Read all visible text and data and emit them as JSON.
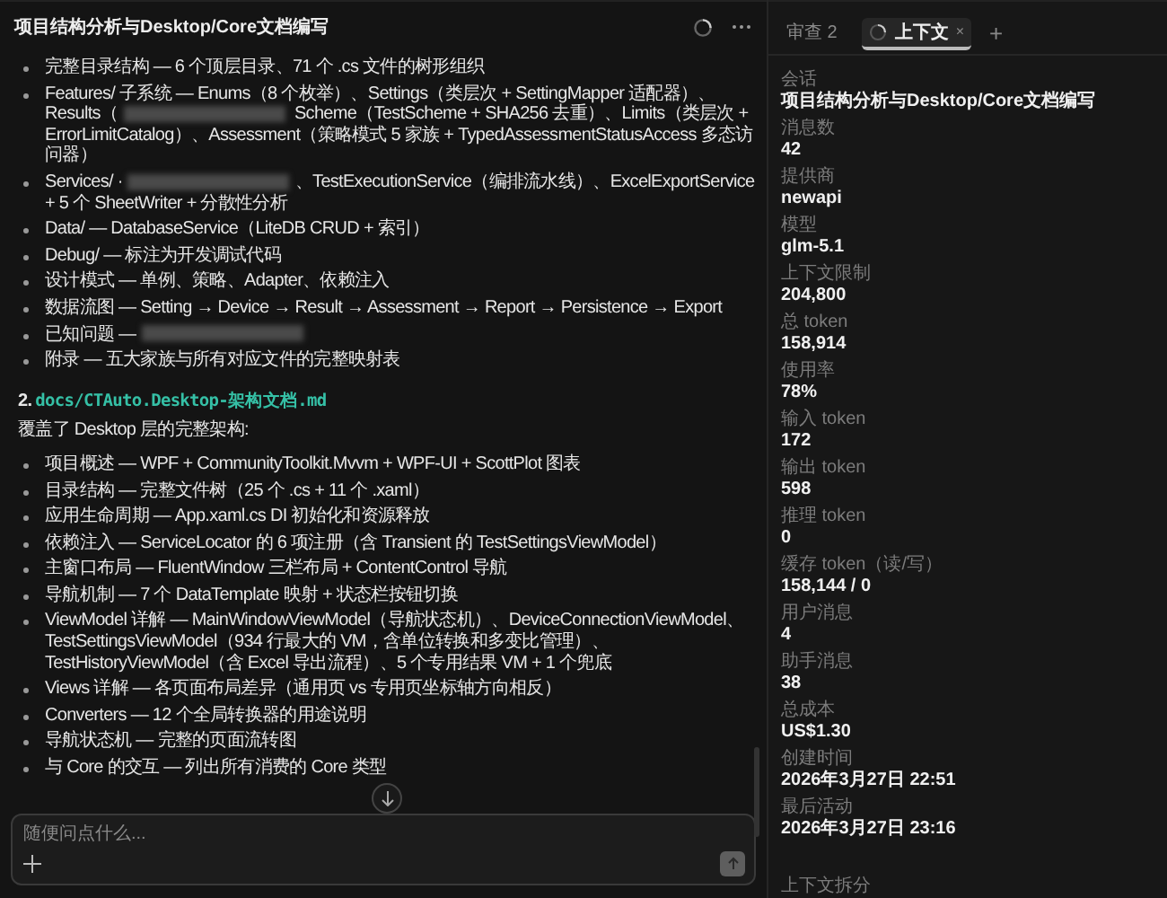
{
  "header": {
    "title": "项目结构分析与Desktop/Core文档编写"
  },
  "message": {
    "list_1": [
      {
        "parts": [
          {
            "kind": "text",
            "text": "完整目录结构 — 6 个顶层目录、71 个 .cs 文件的树形组织"
          }
        ]
      },
      {
        "parts": [
          {
            "kind": "text",
            "text": "Features/ 子系统 — Enums（8 个枚举）、Settings（类层次 + SettingMapper 适配器）、Results（"
          },
          {
            "kind": "redacted"
          },
          {
            "kind": "text",
            "text": " Scheme（TestScheme + SHA256 去重）、Limits（类层次 + ErrorLimitCatalog）、Assessment（策略模式 5 家族 + TypedAssessmentStatusAccess 多态访问器）"
          }
        ]
      },
      {
        "parts": [
          {
            "kind": "text",
            "text": "Services/ ·"
          },
          {
            "kind": "redacted"
          },
          {
            "kind": "text",
            "text": "、TestExecutionService（编排流水线）、ExcelExportService + 5 个 SheetWriter + 分散性分析"
          }
        ]
      },
      {
        "parts": [
          {
            "kind": "text",
            "text": "Data/ — DatabaseService（LiteDB CRUD + 索引）"
          }
        ]
      },
      {
        "parts": [
          {
            "kind": "text",
            "text": "Debug/ — 标注为开发调试代码"
          }
        ]
      },
      {
        "parts": [
          {
            "kind": "text",
            "text": "设计模式 — 单例、策略、Adapter、依赖注入"
          }
        ]
      },
      {
        "parts": [
          {
            "kind": "text",
            "text": "数据流图 — Setting → Device → Result → Assessment → Report → Persistence → Export"
          }
        ]
      },
      {
        "parts": [
          {
            "kind": "text",
            "text": "已知问题 —"
          },
          {
            "kind": "redacted"
          }
        ]
      },
      {
        "parts": [
          {
            "kind": "text",
            "text": "附录 — 五大家族与所有对应文件的完整映射表"
          }
        ]
      }
    ],
    "heading": {
      "number": "2.",
      "link": "docs/CTAuto.Desktop-架构文档.md"
    },
    "paragraph": "覆盖了 Desktop 层的完整架构:",
    "list_2": [
      {
        "parts": [
          {
            "kind": "text",
            "text": "项目概述 — WPF + CommunityToolkit.Mvvm + WPF-UI + ScottPlot 图表"
          }
        ]
      },
      {
        "parts": [
          {
            "kind": "text",
            "text": "目录结构 — 完整文件树（25 个 .cs + 11 个 .xaml）"
          }
        ]
      },
      {
        "parts": [
          {
            "kind": "text",
            "text": "应用生命周期 — App.xaml.cs DI 初始化和资源释放"
          }
        ]
      },
      {
        "parts": [
          {
            "kind": "text",
            "text": "依赖注入 — ServiceLocator 的 6 项注册（含 Transient 的 TestSettingsViewModel）"
          }
        ]
      },
      {
        "parts": [
          {
            "kind": "text",
            "text": "主窗口布局 — FluentWindow 三栏布局 + ContentControl 导航"
          }
        ]
      },
      {
        "parts": [
          {
            "kind": "text",
            "text": "导航机制 — 7 个 DataTemplate 映射 + 状态栏按钮切换"
          }
        ]
      },
      {
        "parts": [
          {
            "kind": "text",
            "text": "ViewModel 详解 — MainWindowViewModel（导航状态机）、DeviceConnectionViewModel、TestSettingsViewModel（934 行最大的 VM，含单位转换和多变比管理）、TestHistoryViewModel（含 Excel 导出流程）、5 个专用结果 VM + 1 个兜底"
          }
        ]
      },
      {
        "parts": [
          {
            "kind": "text",
            "text": "Views 详解 — 各页面布局差异（通用页 vs 专用页坐标轴方向相反）"
          }
        ]
      },
      {
        "parts": [
          {
            "kind": "text",
            "text": "Converters — 12 个全局转换器的用途说明"
          }
        ]
      },
      {
        "parts": [
          {
            "kind": "text",
            "text": "导航状态机 — 完整的页面流转图"
          }
        ]
      },
      {
        "parts": [
          {
            "kind": "text",
            "text": "与 Core 的交互 — 列出所有消费的 Core 类型"
          }
        ]
      }
    ]
  },
  "composer": {
    "placeholder": "随便问点什么..."
  },
  "side_panel": {
    "tabs": [
      {
        "label": "审查 2",
        "selected": false
      },
      {
        "label": "上下文",
        "selected": true,
        "close": "×"
      }
    ],
    "add_tab": "+",
    "fields": [
      {
        "label": "会话",
        "value": "项目结构分析与Desktop/Core文档编写"
      },
      {
        "label": "消息数",
        "value": "42"
      },
      {
        "label": "提供商",
        "value": "newapi"
      },
      {
        "label": "模型",
        "value": "glm-5.1"
      },
      {
        "label": "上下文限制",
        "value": "204,800"
      },
      {
        "label": "总 token",
        "value": "158,914"
      },
      {
        "label": "使用率",
        "value": "78%"
      },
      {
        "label": "输入 token",
        "value": "172"
      },
      {
        "label": "输出 token",
        "value": "598"
      },
      {
        "label": "推理 token",
        "value": "0"
      },
      {
        "label": "缓存 token（读/写）",
        "value": "158,144 / 0"
      },
      {
        "label": "用户消息",
        "value": "4"
      },
      {
        "label": "助手消息",
        "value": "38"
      },
      {
        "label": "总成本",
        "value": "US$1.30"
      },
      {
        "label": "创建时间",
        "value": "2026年3月27日 22:51"
      },
      {
        "label": "最后活动",
        "value": "2026年3月27日 23:16"
      }
    ],
    "section_title": "上下文拆分"
  }
}
